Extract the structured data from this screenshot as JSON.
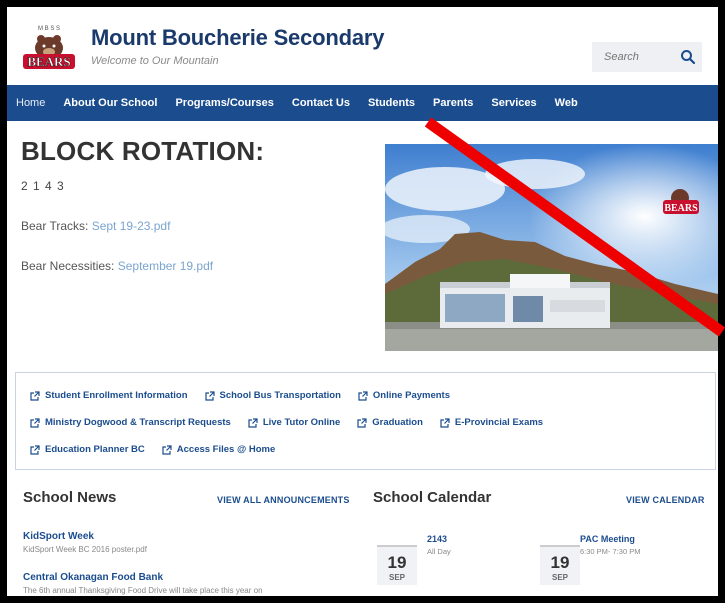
{
  "header": {
    "logo_text": "BEARS",
    "logo_arc": "M B S S",
    "title": "Mount Boucherie Secondary",
    "subtitle": "Welcome to Our Mountain",
    "search_placeholder": "Search"
  },
  "nav": {
    "items": [
      {
        "label": "Home"
      },
      {
        "label": "About Our School"
      },
      {
        "label": "Programs/Courses"
      },
      {
        "label": "Contact Us"
      },
      {
        "label": "Students"
      },
      {
        "label": "Parents"
      },
      {
        "label": "Services"
      },
      {
        "label": "Web"
      }
    ]
  },
  "main": {
    "heading": "BLOCK ROTATION:",
    "rotation": "2 1 4 3",
    "bear_tracks_label": "Bear Tracks:",
    "bear_tracks_link": "Sept 19-23.pdf",
    "bear_necessities_label": "Bear Necessities:",
    "bear_necessities_link": "September 19.pdf"
  },
  "quick_links": {
    "row1": [
      "Student Enrollment Information",
      "School Bus Transportation",
      "Online Payments"
    ],
    "row2": [
      "Ministry Dogwood & Transcript Requests",
      "Live Tutor Online",
      "Graduation",
      "E-Provincial Exams"
    ],
    "row3": [
      "Education Planner BC",
      "Access Files @ Home"
    ]
  },
  "news": {
    "title": "School News",
    "view_all": "VIEW ALL ANNOUNCEMENTS",
    "items": [
      {
        "title": "KidSport Week",
        "desc": "KidSport Week BC 2016 poster.pdf"
      },
      {
        "title": "Central Okanagan Food Bank",
        "desc": "The 6th annual Thanksgiving Food Drive will take place this year on"
      }
    ]
  },
  "calendar": {
    "title": "School Calendar",
    "view_all": "VIEW CALENDAR",
    "events": [
      {
        "day": "19",
        "month": "SEP",
        "title": "2143",
        "time": "All Day"
      },
      {
        "day": "19",
        "month": "SEP",
        "title": "PAC Meeting",
        "time": "6:30 PM- 7:30 PM"
      }
    ]
  },
  "colors": {
    "brand_blue": "#1b4d8e",
    "annotation_slash": "#ee0000"
  },
  "icons": [
    "search-icon",
    "external-link-icon"
  ]
}
